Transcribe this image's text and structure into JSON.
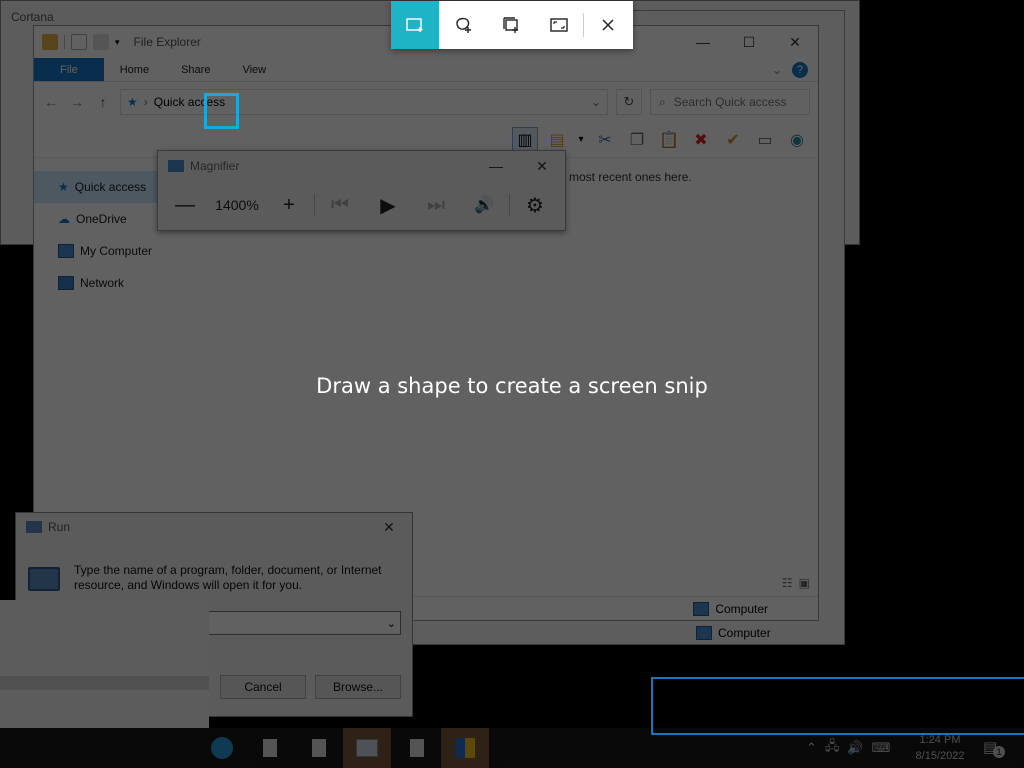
{
  "cortana": {
    "title": "Cortana"
  },
  "explorer": {
    "title": "File Explorer",
    "ribbon_tabs": [
      "File",
      "Home",
      "Share",
      "View"
    ],
    "address": "Quick access",
    "search_placeholder": "Search Quick access",
    "nav_items": [
      "Quick access",
      "OneDrive",
      "My Computer",
      "Network"
    ],
    "content_hint": "most recent ones here.",
    "status_computer": "Computer",
    "status_computer_2": "Computer"
  },
  "magnifier": {
    "title": "Magnifier",
    "zoom": "1400%"
  },
  "run": {
    "title": "Run",
    "description": "Type the name of a program, folder, document, or Internet resource, and Windows will open it for you.",
    "cancel_label": "Cancel",
    "browse_label": "Browse..."
  },
  "snip": {
    "hint": "Draw a shape to create a screen snip",
    "active_mode": "rectangular-snip"
  },
  "taskbar": {
    "time": "1:24 PM",
    "date": "8/15/2022",
    "notification_count": "1"
  },
  "colors": {
    "snip_accent": "#1fb3c6",
    "explorer_file_tab": "#1979ca",
    "focus_box": "#1aa8d8"
  }
}
